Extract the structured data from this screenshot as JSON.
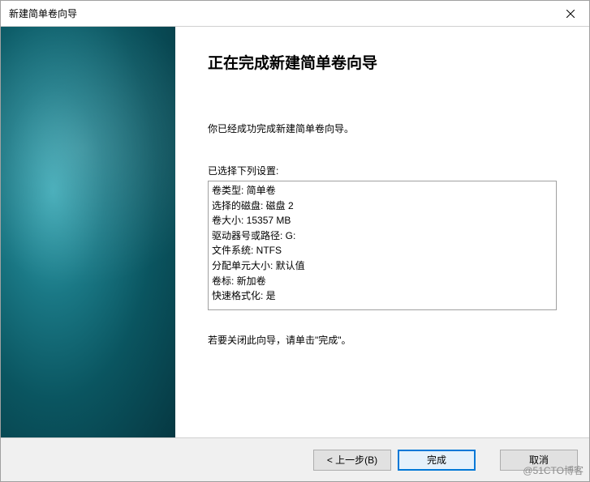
{
  "window": {
    "title": "新建简单卷向导"
  },
  "main": {
    "heading": "正在完成新建简单卷向导",
    "intro": "你已经成功完成新建简单卷向导。",
    "settings_label": "已选择下列设置:",
    "settings": [
      "卷类型: 简单卷",
      "选择的磁盘: 磁盘 2",
      "卷大小: 15357 MB",
      "驱动器号或路径: G:",
      "文件系统: NTFS",
      "分配单元大小: 默认值",
      "卷标: 新加卷",
      "快速格式化: 是"
    ],
    "closing": "若要关闭此向导，请单击\"完成\"。"
  },
  "buttons": {
    "back": "< 上一步(B)",
    "finish": "完成",
    "cancel": "取消"
  },
  "watermark": "@51CTO博客"
}
